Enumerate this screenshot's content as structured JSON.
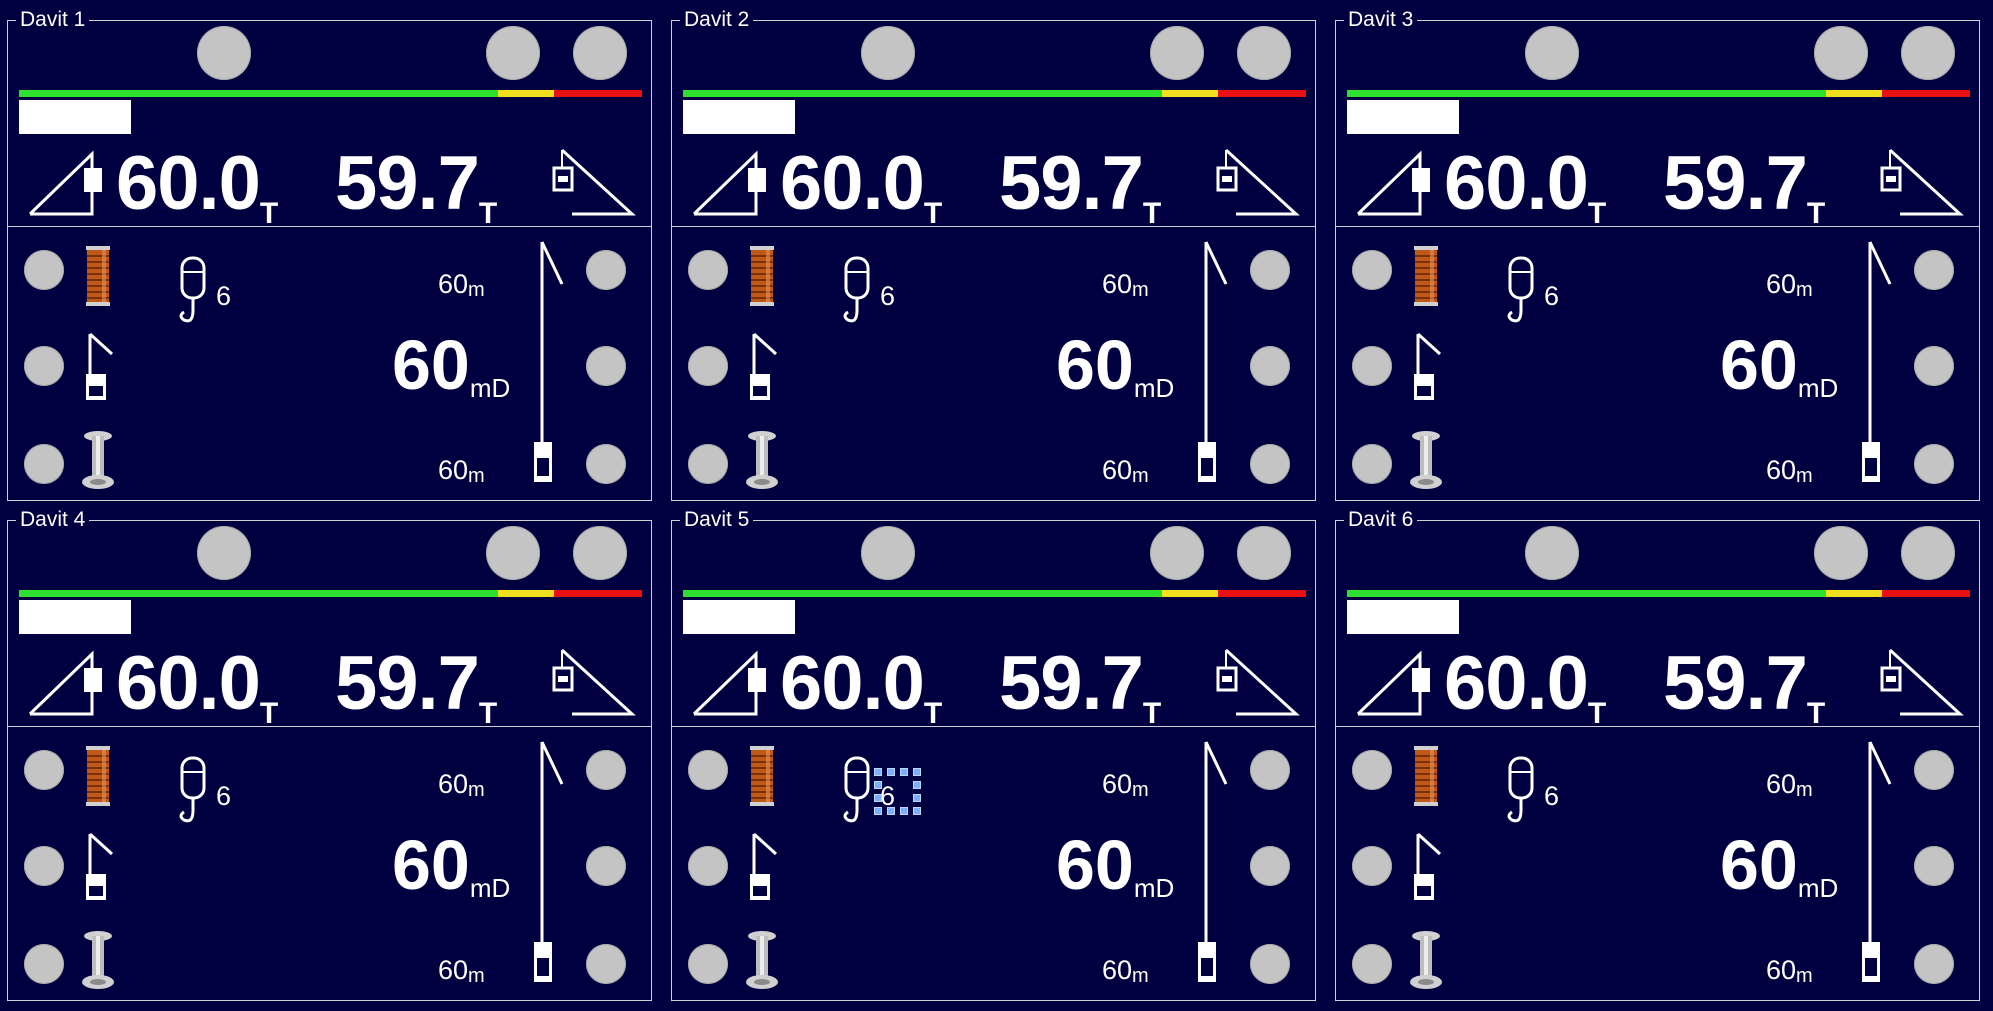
{
  "colors": {
    "background": "#000040",
    "frame": "#d0d0d0",
    "button": "#c4c4c4",
    "bar_green": "#2ee02e",
    "bar_yellow": "#f0e020",
    "bar_red": "#e81010",
    "drum": "#c05818"
  },
  "icons": {
    "boom_load": "davit-boom-load-icon",
    "boom_load_right": "davit-boom-load-right-icon",
    "winch_drum": "winch-drum-icon",
    "hook": "hook-block-icon",
    "davit_arm": "davit-arm-icon",
    "bollard": "bollard-icon",
    "wire_depth": "wire-depth-gauge-icon"
  },
  "panels": [
    {
      "title": "Davit 1",
      "load_set": "60.0",
      "load_set_unit": "T",
      "load_actual": "59.7",
      "load_actual_unit": "T",
      "progress": 0.18,
      "hook_count": "6",
      "depth_top": "60",
      "depth_top_unit": "m",
      "depth_main": "60",
      "depth_main_unit": "mD",
      "depth_bottom": "60",
      "depth_bottom_unit": "m",
      "selected": false
    },
    {
      "title": "Davit 2",
      "load_set": "60.0",
      "load_set_unit": "T",
      "load_actual": "59.7",
      "load_actual_unit": "T",
      "progress": 0.18,
      "hook_count": "6",
      "depth_top": "60",
      "depth_top_unit": "m",
      "depth_main": "60",
      "depth_main_unit": "mD",
      "depth_bottom": "60",
      "depth_bottom_unit": "m",
      "selected": false
    },
    {
      "title": "Davit 3",
      "load_set": "60.0",
      "load_set_unit": "T",
      "load_actual": "59.7",
      "load_actual_unit": "T",
      "progress": 0.18,
      "hook_count": "6",
      "depth_top": "60",
      "depth_top_unit": "m",
      "depth_main": "60",
      "depth_main_unit": "mD",
      "depth_bottom": "60",
      "depth_bottom_unit": "m",
      "selected": false
    },
    {
      "title": "Davit 4",
      "load_set": "60.0",
      "load_set_unit": "T",
      "load_actual": "59.7",
      "load_actual_unit": "T",
      "progress": 0.18,
      "hook_count": "6",
      "depth_top": "60",
      "depth_top_unit": "m",
      "depth_main": "60",
      "depth_main_unit": "mD",
      "depth_bottom": "60",
      "depth_bottom_unit": "m",
      "selected": false
    },
    {
      "title": "Davit 5",
      "load_set": "60.0",
      "load_set_unit": "T",
      "load_actual": "59.7",
      "load_actual_unit": "T",
      "progress": 0.18,
      "hook_count": "6",
      "depth_top": "60",
      "depth_top_unit": "m",
      "depth_main": "60",
      "depth_main_unit": "mD",
      "depth_bottom": "60",
      "depth_bottom_unit": "m",
      "selected": true
    },
    {
      "title": "Davit 6",
      "load_set": "60.0",
      "load_set_unit": "T",
      "load_actual": "59.7",
      "load_actual_unit": "T",
      "progress": 0.18,
      "hook_count": "6",
      "depth_top": "60",
      "depth_top_unit": "m",
      "depth_main": "60",
      "depth_main_unit": "mD",
      "depth_bottom": "60",
      "depth_bottom_unit": "m",
      "selected": false
    }
  ]
}
